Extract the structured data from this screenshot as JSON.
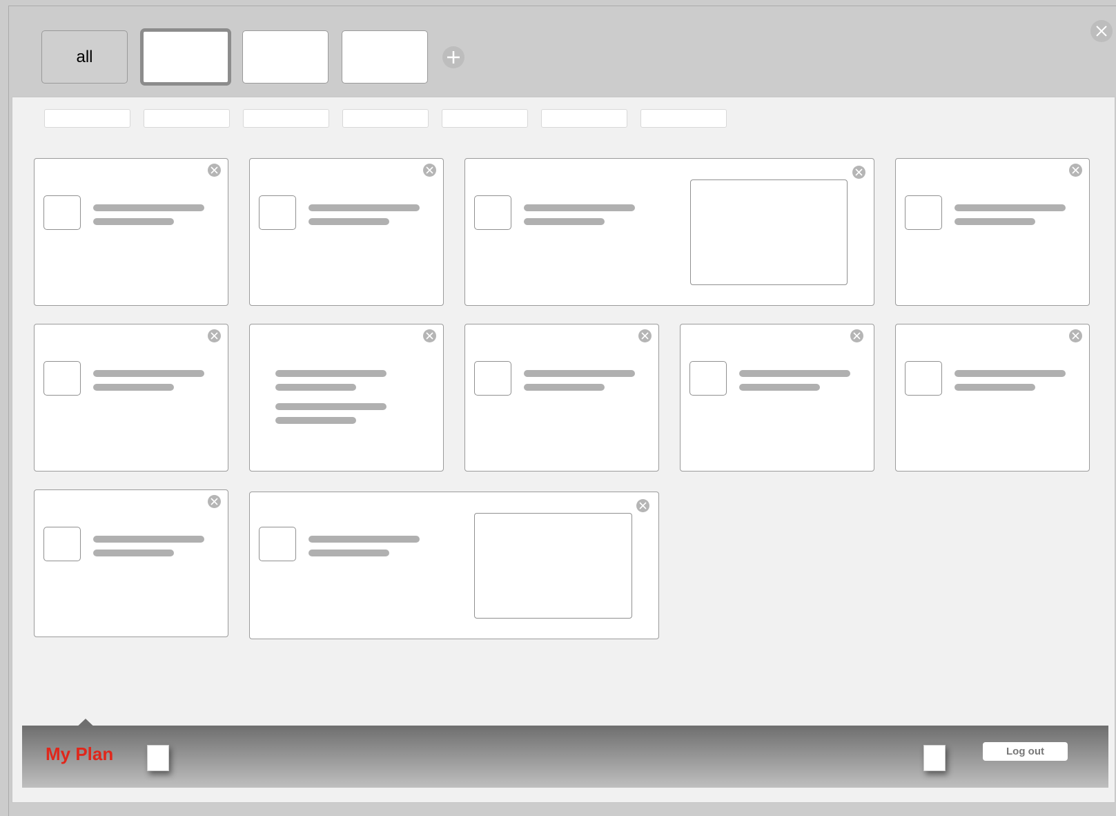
{
  "tabs": {
    "all_label": "all"
  },
  "footer": {
    "title": "My Plan",
    "logout_label": "Log out"
  },
  "colors": {
    "accent": "#e0271b",
    "background": "#cccccc",
    "content_bg": "#f1f1f1"
  }
}
